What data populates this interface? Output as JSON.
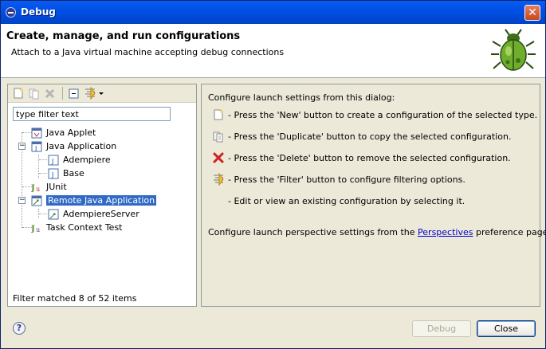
{
  "window": {
    "title": "Debug"
  },
  "header": {
    "title": "Create, manage, and run configurations",
    "message": "Attach to a Java virtual machine accepting debug connections"
  },
  "left": {
    "filter_placeholder": "type filter text",
    "filter_value": "type filter text",
    "tree": [
      {
        "label": "Java Applet",
        "icon": "java-applet-icon",
        "level": 0,
        "expanded": null
      },
      {
        "label": "Java Application",
        "icon": "java-application-icon",
        "level": 0,
        "expanded": true
      },
      {
        "label": "Adempiere",
        "icon": "java-config-icon",
        "level": 1,
        "expanded": null
      },
      {
        "label": "Base",
        "icon": "java-config-icon",
        "level": 1,
        "expanded": null
      },
      {
        "label": "JUnit",
        "icon": "junit-icon",
        "level": 0,
        "expanded": null
      },
      {
        "label": "Remote Java Application",
        "icon": "remote-java-icon",
        "level": 0,
        "expanded": true,
        "selected": true
      },
      {
        "label": "AdempiereServer",
        "icon": "remote-config-icon",
        "level": 1,
        "expanded": null
      },
      {
        "label": "Task Context Test",
        "icon": "task-context-icon",
        "level": 0,
        "expanded": null
      }
    ],
    "status": "Filter matched 8 of 52 items"
  },
  "right": {
    "intro": "Configure launch settings from this dialog:",
    "items": [
      {
        "icon": "new-config-icon",
        "text": "- Press the 'New' button to create a configuration of the selected type."
      },
      {
        "icon": "duplicate-icon",
        "text": "- Press the 'Duplicate' button to copy the selected configuration."
      },
      {
        "icon": "delete-icon",
        "text": "- Press the 'Delete' button to remove the selected configuration."
      },
      {
        "icon": "filter-icon",
        "text": "- Press the 'Filter' button to configure filtering options."
      },
      {
        "icon": "",
        "text": "- Edit or view an existing configuration by selecting it."
      }
    ],
    "perspective_before": "Configure launch perspective settings from the ",
    "perspective_link": "Perspectives",
    "perspective_after": " preference page."
  },
  "buttons": {
    "debug": "Debug",
    "close": "Close",
    "help": "?"
  },
  "colors": {
    "selection": "#316ac5",
    "titlebar": "#0050e6",
    "link": "#0000cc"
  }
}
